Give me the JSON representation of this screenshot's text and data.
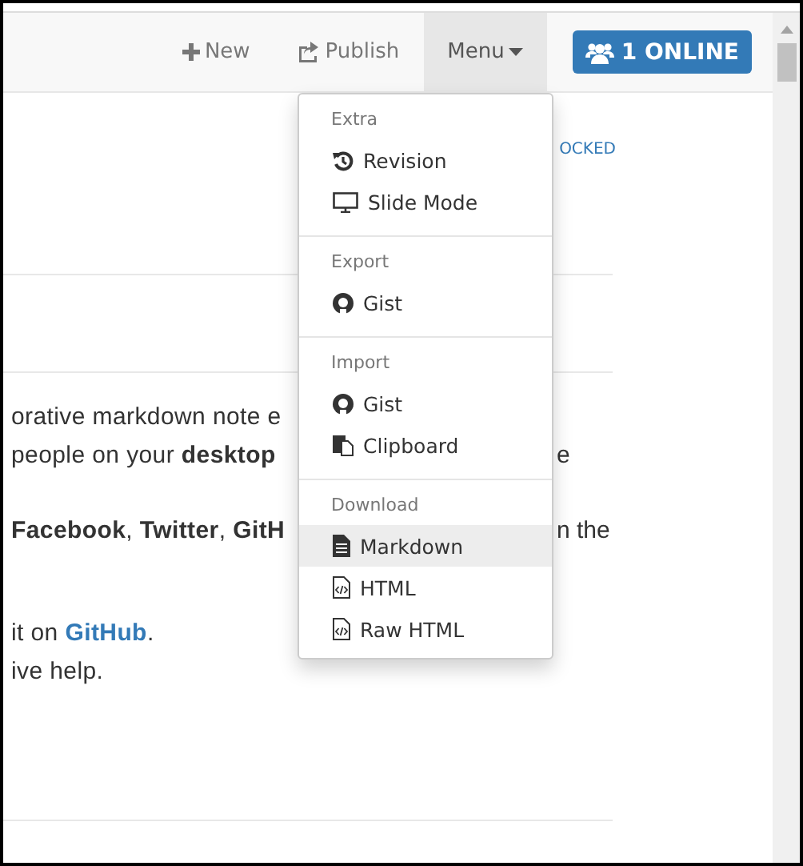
{
  "navbar": {
    "items": [
      {
        "kind": "new",
        "label": "New",
        "active": false
      },
      {
        "kind": "publish",
        "label": "Publish",
        "active": false
      },
      {
        "kind": "menu",
        "label": "Menu",
        "active": true
      }
    ],
    "online_button": {
      "label": "1 ONLINE"
    }
  },
  "status": "OCKED",
  "menu": {
    "sections": [
      {
        "header": "Extra",
        "items": [
          {
            "kind": "history",
            "label": "Revision",
            "highlighted": false
          },
          {
            "kind": "desktop",
            "label": "Slide Mode",
            "highlighted": false
          }
        ]
      },
      {
        "header": "Export",
        "items": [
          {
            "kind": "github",
            "label": "Gist",
            "highlighted": false
          }
        ]
      },
      {
        "header": "Import",
        "items": [
          {
            "kind": "github",
            "label": "Gist",
            "highlighted": false
          },
          {
            "kind": "clipboard",
            "label": "Clipboard",
            "highlighted": false
          }
        ]
      },
      {
        "header": "Download",
        "items": [
          {
            "kind": "file",
            "label": "Markdown",
            "highlighted": true
          },
          {
            "kind": "file-code",
            "label": "HTML",
            "highlighted": false
          },
          {
            "kind": "file-code",
            "label": "Raw HTML",
            "highlighted": false
          }
        ]
      }
    ]
  },
  "paragraphs": [
    {
      "lines": [
        {
          "left": [
            {
              "kind": "plain",
              "text": "orative markdown note e"
            }
          ]
        },
        {
          "left": [
            {
              "kind": "plain",
              "text": "people on your "
            },
            {
              "kind": "bold",
              "text": "desktop"
            }
          ],
          "right": "e"
        }
      ]
    },
    {
      "lines": [
        {
          "left": [
            {
              "kind": "bold",
              "text": "Facebook"
            },
            {
              "kind": "plain",
              "text": ", "
            },
            {
              "kind": "bold",
              "text": "Twitter"
            },
            {
              "kind": "plain",
              "text": ", "
            },
            {
              "kind": "bold",
              "text": "GitH"
            }
          ],
          "right": "n the"
        }
      ]
    },
    {
      "lines": [
        {
          "left": [
            {
              "kind": "plain",
              "text": "it on "
            },
            {
              "kind": "link",
              "text": "GitHub"
            },
            {
              "kind": "plain",
              "text": "."
            }
          ]
        },
        {
          "left": [
            {
              "kind": "plain",
              "text": "ive help."
            }
          ]
        }
      ]
    }
  ]
}
